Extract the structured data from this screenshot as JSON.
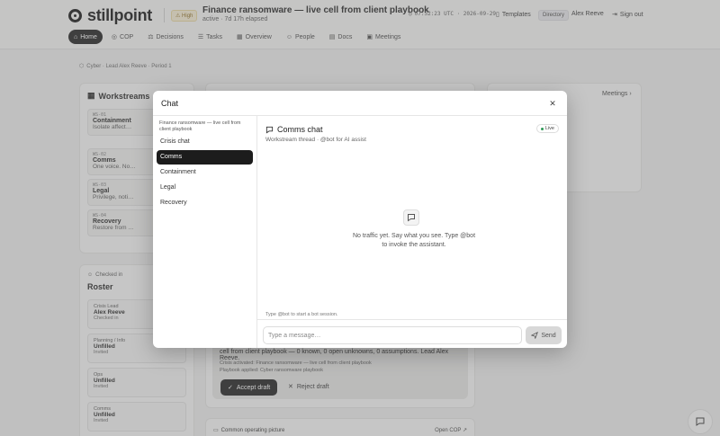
{
  "app": {
    "name": "stillpoint",
    "severity": "High",
    "incident_title": "Finance ransomware — live cell from client playbook",
    "incident_status": "active · 7d 17h elapsed",
    "clock": "07:52:23 UTC · 2026-09-29",
    "templates_label": "Templates",
    "directory_label": "Directory",
    "user_name": "Alex Reeve",
    "signout_label": "Sign out"
  },
  "nav": {
    "items": [
      {
        "label": "Home",
        "icon": "home-icon",
        "active": true
      },
      {
        "label": "COP",
        "icon": "globe-icon"
      },
      {
        "label": "Decisions",
        "icon": "scale-icon"
      },
      {
        "label": "Tasks",
        "icon": "list-icon"
      },
      {
        "label": "Overview",
        "icon": "grid-icon"
      },
      {
        "label": "People",
        "icon": "person-icon"
      },
      {
        "label": "Docs",
        "icon": "doc-icon"
      },
      {
        "label": "Meetings",
        "icon": "calendar-icon"
      }
    ]
  },
  "breadcrumb": "Cyber · Lead Alex Reeve · Period 1",
  "workstreams": {
    "title": "Workstreams",
    "items": [
      {
        "id": "WS-01",
        "name": "Containment",
        "desc": "Isolate affect…"
      },
      {
        "id": "WS-02",
        "name": "Comms",
        "desc": "One voice. No…"
      },
      {
        "id": "WS-03",
        "name": "Legal",
        "desc": "Privilege, noti…"
      },
      {
        "id": "WS-04",
        "name": "Recovery",
        "desc": "Restore from …"
      }
    ]
  },
  "roster": {
    "checked_in_label": "Checked in",
    "title": "Roster",
    "items": [
      {
        "role": "Crisis Lead",
        "name": "Alex Reeve",
        "status": "Checked in"
      },
      {
        "role": "Planning / Info",
        "name": "Unfilled",
        "status": "Invited"
      },
      {
        "role": "Ops",
        "name": "Unfilled",
        "status": "Invited"
      },
      {
        "role": "Comms",
        "name": "Unfilled",
        "status": "Invited"
      }
    ]
  },
  "draft": {
    "text": "cell from client playbook — 0 known, 0 open unknowns, 0 assumptions. Lead Alex Reeve.",
    "meta_1": "Crisis activated: Finance ransomware — live cell from client playbook",
    "meta_2": "Playbook applied: Cyber ransomware playbook",
    "accept_label": "Accept draft",
    "reject_label": "Reject draft"
  },
  "cop": {
    "title": "Common operating picture",
    "link": "Open COP ↗"
  },
  "meetings_link": "Meetings ›",
  "chat": {
    "title": "Chat",
    "context": "Finance ransomware — live cell from client playbook",
    "channels": [
      {
        "label": "Crisis chat",
        "active": false
      },
      {
        "label": "Comms",
        "active": true
      },
      {
        "label": "Containment",
        "active": false
      },
      {
        "label": "Legal",
        "active": false
      },
      {
        "label": "Recovery",
        "active": false
      }
    ],
    "channel_title": "Comms chat",
    "channel_sub": "Workstream thread · @bot for AI assist",
    "live_label": "Live",
    "empty_text": "No traffic yet. Say what you see. Type @bot to invoke the assistant.",
    "hint": "Type @bot to start a bot session.",
    "input_placeholder": "Type a message…",
    "send_label": "Send"
  }
}
